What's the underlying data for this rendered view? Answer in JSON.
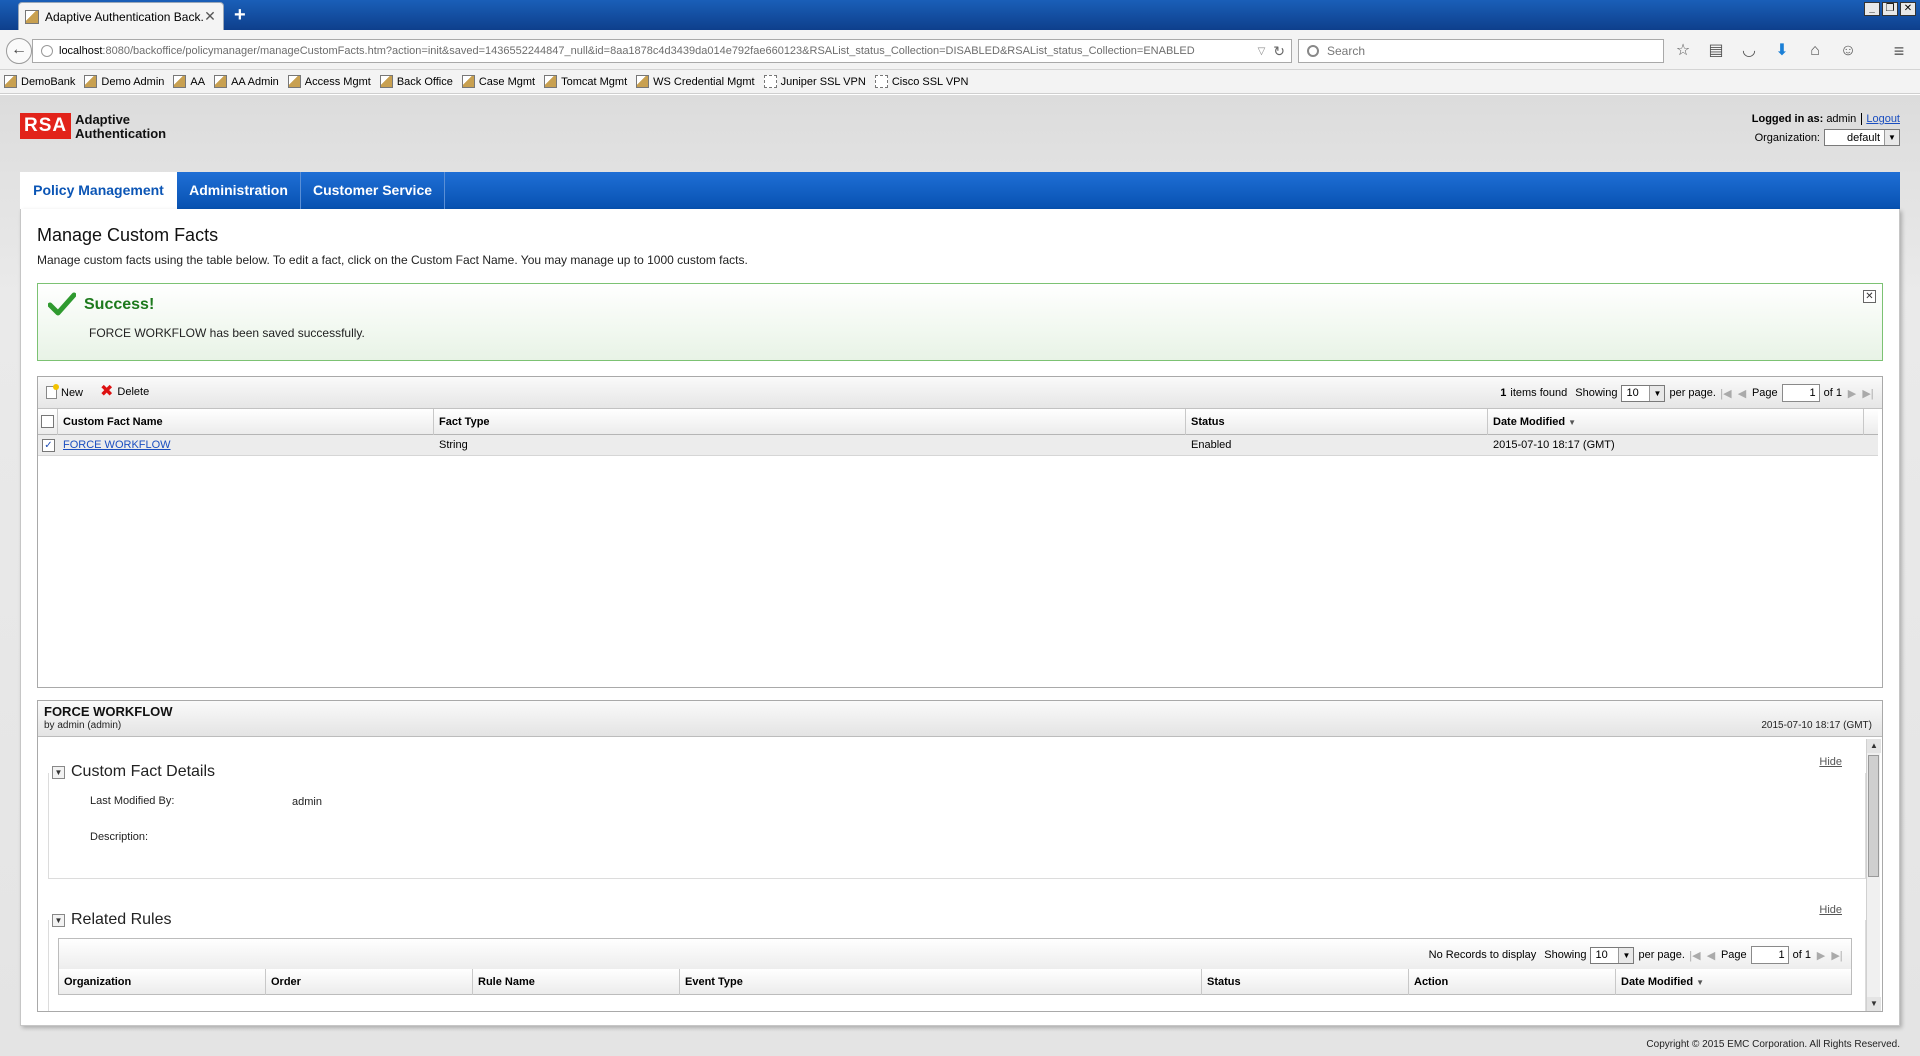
{
  "browser": {
    "tab_title": "Adaptive Authentication Back...",
    "url_host": "localhost",
    "url_path": ":8080/backoffice/policymanager/manageCustomFacts.htm?action=init&saved=1436552244847_null&id=8aa1878c4d3439da014e792fae660123&RSAList_status_Collection=DISABLED&RSAList_status_Collection=ENABLED",
    "search_placeholder": "Search",
    "bookmarks": [
      {
        "label": "DemoBank",
        "icon": "page-icon"
      },
      {
        "label": "Demo Admin",
        "icon": "page-icon"
      },
      {
        "label": "AA",
        "icon": "page-icon"
      },
      {
        "label": "AA Admin",
        "icon": "page-icon"
      },
      {
        "label": "Access Mgmt",
        "icon": "page-icon"
      },
      {
        "label": "Back Office",
        "icon": "page-icon"
      },
      {
        "label": "Case Mgmt",
        "icon": "page-icon"
      },
      {
        "label": "Tomcat Mgmt",
        "icon": "page-icon"
      },
      {
        "label": "WS Credential Mgmt",
        "icon": "page-icon"
      },
      {
        "label": "Juniper SSL VPN",
        "icon": "blank-page-icon"
      },
      {
        "label": "Cisco SSL VPN",
        "icon": "blank-page-icon"
      }
    ]
  },
  "header": {
    "logo_mark": "RSA",
    "logo_line1": "Adaptive",
    "logo_line2": "Authentication",
    "logged_in_label": "Logged in as:",
    "logged_in_user": "admin",
    "logout_label": "Logout",
    "organization_label": "Organization:",
    "organization_value": "default"
  },
  "nav": {
    "tabs": [
      {
        "label": "Policy Management",
        "active": true
      },
      {
        "label": "Administration",
        "active": false
      },
      {
        "label": "Customer Service",
        "active": false
      }
    ]
  },
  "main": {
    "title": "Manage Custom Facts",
    "description": "Manage custom facts using the table below. To edit a fact, click on the Custom Fact Name. You may manage up to 1000 custom facts.",
    "success_title": "Success!",
    "success_message": "FORCE WORKFLOW has been saved successfully.",
    "toolbar": {
      "new_label": "New",
      "delete_label": "Delete",
      "items_count": "1",
      "items_found_label": "items found",
      "showing_label": "Showing",
      "per_page_value": "10",
      "per_page_label": "per page.",
      "page_label": "Page",
      "page_value": "1",
      "of_label": "of 1"
    },
    "columns": [
      "Custom Fact Name",
      "Fact Type",
      "Status",
      "Date Modified"
    ],
    "rows": [
      {
        "name": "FORCE WORKFLOW",
        "type": "String",
        "status": "Enabled",
        "date": "2015-07-10 18:17 (GMT)",
        "checked": true
      }
    ]
  },
  "detail": {
    "title": "FORCE WORKFLOW",
    "subtitle": "by admin (admin)",
    "date": "2015-07-10 18:17 (GMT)",
    "section1_title": "Custom Fact Details",
    "hide_label": "Hide",
    "last_modified_label": "Last Modified By:",
    "last_modified_value": "admin",
    "description_label": "Description:",
    "section2_title": "Related Rules",
    "rules_toolbar": {
      "no_records": "No Records to display",
      "showing_label": "Showing",
      "per_page_value": "10",
      "per_page_label": "per page.",
      "page_label": "Page",
      "page_value": "1",
      "of_label": "of 1"
    },
    "rules_columns": [
      "Organization",
      "Order",
      "Rule Name",
      "Event Type",
      "Status",
      "Action",
      "Date Modified"
    ]
  },
  "footer": {
    "copyright": "Copyright © 2015 EMC Corporation. All Rights Reserved."
  },
  "colors": {
    "brand_red": "#e2231a",
    "nav_blue": "#0b55b5",
    "success_green": "#1d7a1d",
    "link_blue": "#1a4ec0"
  }
}
